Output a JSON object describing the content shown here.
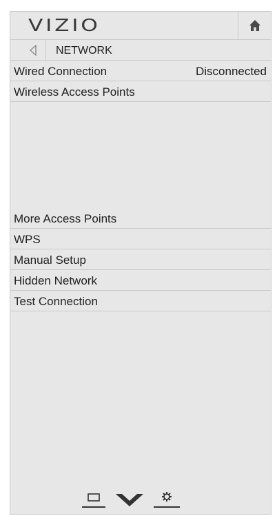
{
  "header": {
    "logo": "VIZIO",
    "home_icon": "home-icon"
  },
  "nav": {
    "back_icon": "back-arrow-icon",
    "title": "NETWORK"
  },
  "menu": {
    "wired_connection": {
      "label": "Wired Connection",
      "value": "Disconnected"
    },
    "wireless_access_points": {
      "label": "Wireless Access Points"
    },
    "items": [
      {
        "label": "More Access Points"
      },
      {
        "label": "WPS"
      },
      {
        "label": "Manual Setup"
      },
      {
        "label": "Hidden Network"
      },
      {
        "label": "Test Connection"
      }
    ]
  },
  "footer": {
    "icons": [
      "input-icon",
      "wide-chevron-down-icon",
      "settings-gear-icon"
    ]
  },
  "colors": {
    "panel_bg": "#e7e7e7",
    "divider": "#c9c9c9",
    "text": "#222222"
  }
}
